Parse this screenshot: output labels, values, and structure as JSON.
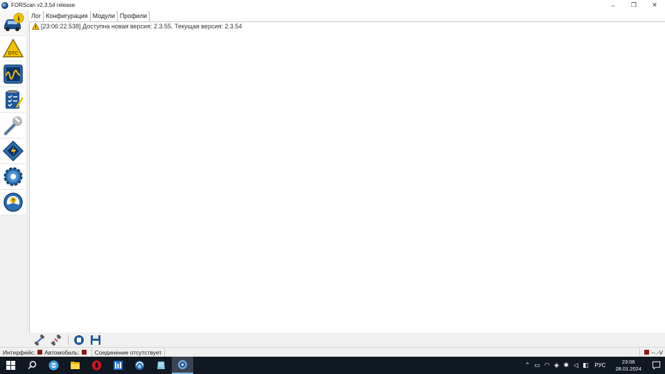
{
  "window": {
    "title": "FORScan v2.3.54 release",
    "minimize": "–",
    "restore": "❐",
    "close": "✕"
  },
  "sidebar": {
    "items": [
      {
        "icon": "vehicle-info-icon"
      },
      {
        "icon": "dtc-icon",
        "label": "DTC"
      },
      {
        "icon": "oscilloscope-icon"
      },
      {
        "icon": "checklist-icon"
      },
      {
        "icon": "wrench-icon"
      },
      {
        "icon": "chip-icon"
      },
      {
        "icon": "settings-gear-icon"
      },
      {
        "icon": "help-icon"
      }
    ]
  },
  "tabs": [
    {
      "label": "Лог",
      "active": true
    },
    {
      "label": "Конфигурация"
    },
    {
      "label": "Модули"
    },
    {
      "label": "Профили"
    }
  ],
  "log": {
    "entries": [
      {
        "icon": "warning-icon",
        "text": "[23:06:22.538] Доступна новая версия: 2.3.55. Текущая версия: 2.3.54"
      }
    ]
  },
  "bottom_toolbar": {
    "buttons": [
      "connect-icon",
      "disconnect-icon",
      "stop-icon",
      "save-icon"
    ]
  },
  "statusbar": {
    "interface_label": "Интерфейс:",
    "vehicle_label": "Автомобиль:",
    "connection_text": "Соединение отсутствует",
    "voltage_text": "--.-V",
    "led_color": "#8b1a1a"
  },
  "taskbar": {
    "apps": [
      "windows-start-icon",
      "search-icon",
      "forscan-alt-icon",
      "file-explorer-icon",
      "opera-icon",
      "calculator-icon",
      "browser-icon",
      "notes-icon",
      "forscan-icon"
    ],
    "language": "РУС",
    "time": "23:06",
    "date": "28.01.2024"
  }
}
